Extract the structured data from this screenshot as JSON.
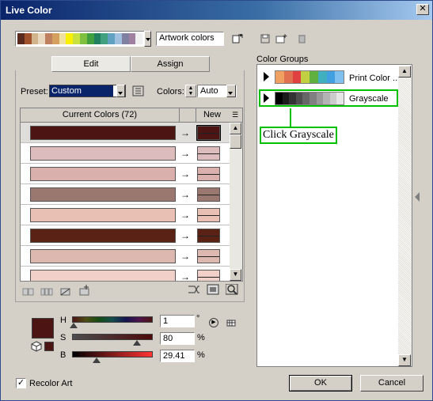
{
  "window": {
    "title": "Live Color",
    "close": "✕"
  },
  "toolbar": {
    "artwork_colors": "Artwork colors",
    "swatches": [
      "#5a2a1e",
      "#a0522d",
      "#d2b48c",
      "#e8d8c0",
      "#c08060",
      "#d4a060",
      "#f0e0a0",
      "#f8f000",
      "#c8e040",
      "#80c040",
      "#40a040",
      "#208060",
      "#40a080",
      "#60a0c0",
      "#a0c0e0",
      "#8080a0",
      "#a080a0",
      "#f0f0f0"
    ]
  },
  "tabs": {
    "edit": "Edit",
    "assign": "Assign"
  },
  "preset": {
    "label": "Preset:",
    "value": "Custom"
  },
  "colors": {
    "label": "Colors:",
    "value": "Auto"
  },
  "table": {
    "current_header": "Current Colors (72)",
    "new_header": "New",
    "rows": [
      {
        "cur": "#4d1414",
        "new": "#4d1414"
      },
      {
        "cur": "#dcbcbc",
        "new": "#dcbcbc"
      },
      {
        "cur": "#d9b0ab",
        "new": "#d9b0ab"
      },
      {
        "cur": "#9a7870",
        "new": "#9a7870"
      },
      {
        "cur": "#e8c0b4",
        "new": "#e8c0b4"
      },
      {
        "cur": "#5a2214",
        "new": "#5a2214"
      },
      {
        "cur": "#dcb8b0",
        "new": "#dcb8b0"
      },
      {
        "cur": "#f0d0c8",
        "new": "#f0d0c8"
      }
    ],
    "arrow": "→"
  },
  "hsb": {
    "h_label": "H",
    "h_value": "1",
    "h_unit": "°",
    "s_label": "S",
    "s_value": "80",
    "s_unit": "%",
    "b_label": "B",
    "b_value": "29.41",
    "b_unit": "%",
    "selected_color": "#4d1414"
  },
  "groups": {
    "label": "Color Groups",
    "items": [
      {
        "name": "Print Color ...",
        "swatches": [
          "#f0a060",
          "#e07050",
          "#e04040",
          "#c0d040",
          "#60b040",
          "#40b0c0",
          "#40a0e0",
          "#80c0f0"
        ]
      },
      {
        "name": "Grayscale",
        "swatches": [
          "#000000",
          "#1a1a1a",
          "#333333",
          "#4d4d4d",
          "#666666",
          "#808080",
          "#999999",
          "#b3b3b3",
          "#cccccc",
          "#e6e6e6"
        ]
      }
    ],
    "annotation": "Click Grayscale"
  },
  "footer": {
    "recolor": "Recolor Art",
    "ok": "OK",
    "cancel": "Cancel"
  },
  "accents": {
    "title_start": "#0a246a",
    "highlight": "#00c000",
    "select_blue": "#0a246a"
  }
}
